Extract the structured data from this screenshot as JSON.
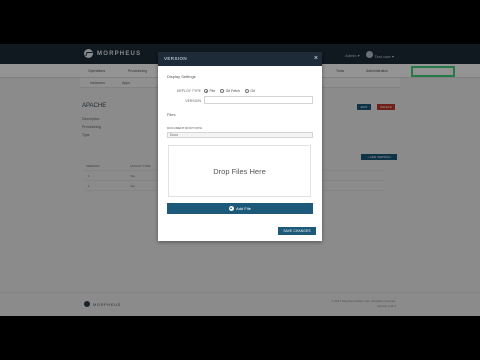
{
  "app": {
    "logo_text": "MORPHEUS"
  },
  "topbar": {
    "user_menu": "Admin ▾",
    "user_name": "Test user ▾"
  },
  "nav": {
    "items": [
      "Operations",
      "Provisioning",
      "Lifecycle",
      "Infrastructure",
      "Backups",
      "Monitoring",
      "Tools",
      "Administration"
    ]
  },
  "background": {
    "page_title": "APACHE",
    "meta_labels": [
      "Description",
      "Provisioning",
      "Type"
    ],
    "subtoolbar_items": [
      "Instances",
      "Apps"
    ],
    "buttons": {
      "edit": "EDIT",
      "delete": "DELETE",
      "add_version": "+ ADD VERSION"
    },
    "table_headers": [
      "VERSION",
      "LAYOUT TYPE"
    ],
    "table_rows": [
      [
        "1",
        "Yes"
      ],
      [
        "1",
        "Yes"
      ]
    ]
  },
  "footer": {
    "logo_text": "MORPHEUS",
    "line1": "© 2017 Morpheus Data, LLC. All rights reserved.",
    "line2": "Version 2.11.3"
  },
  "modal": {
    "title": "VERSION",
    "close_glyph": "×",
    "section_display": "Display Settings",
    "deploy_type_label": "DEPLOY TYPE",
    "deploy_options": [
      "File",
      "Git Fetch",
      "Git"
    ],
    "deploy_selected": 0,
    "version_label": "VERSION",
    "version_value": "",
    "files_heading": "Files",
    "upload_label": "DOCUMENT ROOT PATH",
    "upload_select": "Docs",
    "drop_text": "Drop Files Here",
    "add_file_label": "Add File",
    "save_label": "SAVE CHANGES"
  },
  "colors": {
    "header": "#1d2b38",
    "accent": "#1d5a7a",
    "highlight": "#44d17a",
    "delete": "#c0392b"
  }
}
